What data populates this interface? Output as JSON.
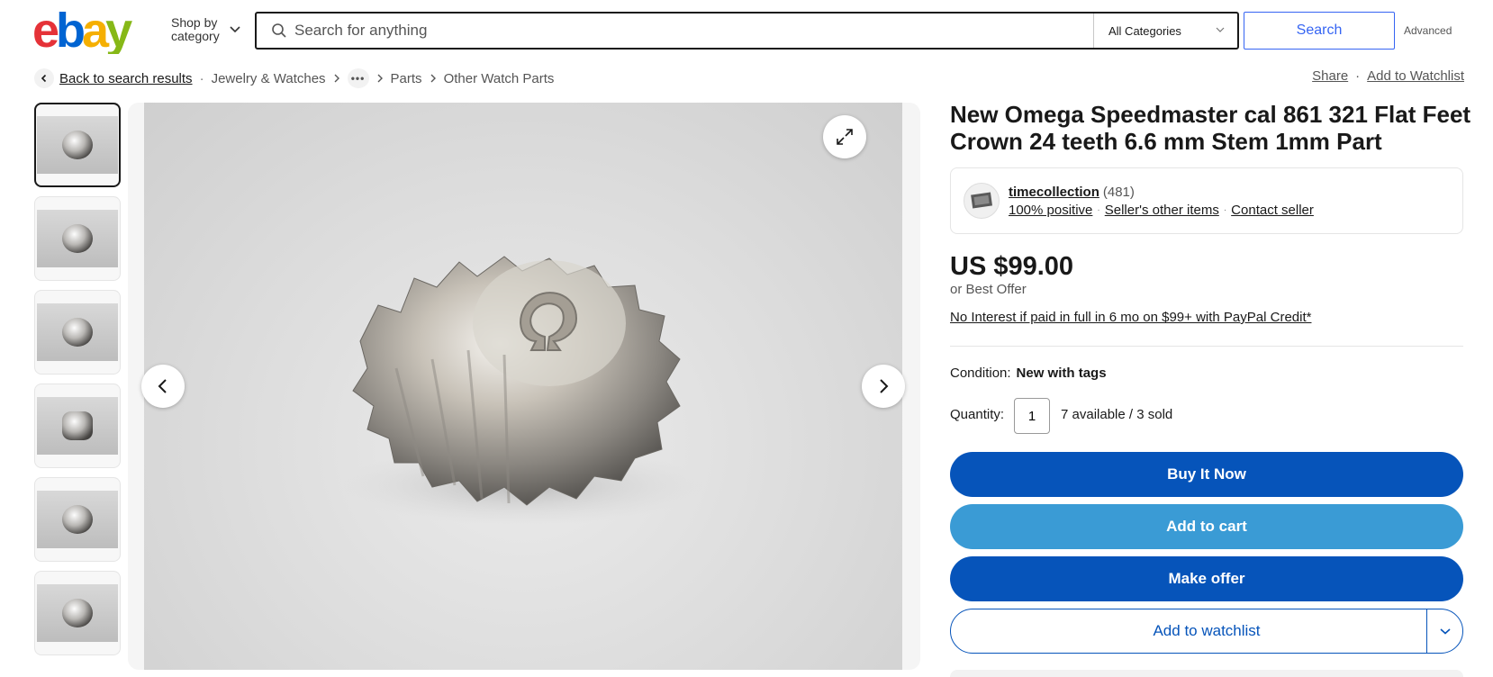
{
  "header": {
    "logo_text": "ebay",
    "shop_by_line1": "Shop by",
    "shop_by_line2": "category",
    "search_placeholder": "Search for anything",
    "category_selected": "All Categories",
    "search_button": "Search",
    "advanced_link": "Advanced"
  },
  "breadcrumb": {
    "back": "Back to search results",
    "items": [
      "Jewelry & Watches",
      "Parts",
      "Other Watch Parts"
    ],
    "more": "•••"
  },
  "top_actions": {
    "share": "Share",
    "watchlist": "Add to Watchlist"
  },
  "thumbnails_count": 6,
  "listing": {
    "title": "New Omega Speedmaster cal 861 321 Flat Feet Crown 24 teeth 6.6 mm Stem 1mm Part",
    "seller": {
      "name": "timecollection",
      "feedback": "(481)",
      "positive": "100% positive",
      "other_items": "Seller's other items",
      "contact": "Contact seller"
    },
    "price": "US $99.00",
    "best_offer": "or Best Offer",
    "credit": "No Interest if paid in full in 6 mo on $99+ with PayPal Credit*",
    "condition_label": "Condition:",
    "condition_value": "New with tags",
    "quantity_label": "Quantity:",
    "quantity_value": "1",
    "availability": "7 available / 3 sold"
  },
  "buttons": {
    "buy_now": "Buy It Now",
    "add_to_cart": "Add to cart",
    "make_offer": "Make offer",
    "add_to_watchlist": "Add to watchlist"
  },
  "colors": {
    "primary_blue": "#0654ba",
    "cart_blue": "#3a9bd5",
    "search_blue": "#3665f3",
    "logo_red": "#e53238",
    "logo_blue": "#0064d2",
    "logo_yellow": "#f5af02",
    "logo_green": "#86b817"
  }
}
